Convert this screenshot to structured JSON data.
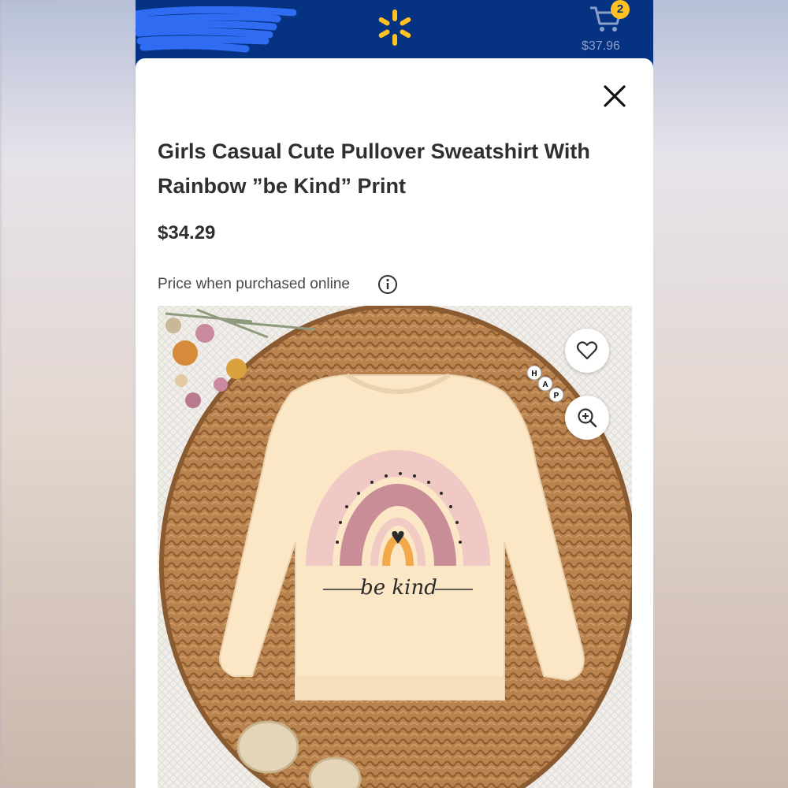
{
  "header": {
    "cart_count": "2",
    "cart_total": "$37.96",
    "logo_icon": "walmart-spark-icon",
    "cart_icon": "cart-icon",
    "brand_color": "#053281",
    "accent_color": "#ffc220"
  },
  "product": {
    "title": "Girls Casual Cute Pullover Sweatshirt With Rainbow ”be Kind” Print",
    "price": "$34.29",
    "price_note": "Price when purchased online",
    "shirt_print": "be kind",
    "bead_letters": [
      "H",
      "A",
      "P"
    ]
  },
  "actions": {
    "close_icon": "close-icon",
    "info_icon": "info-icon",
    "favorite_icon": "heart-icon",
    "zoom_icon": "zoom-in-icon"
  }
}
